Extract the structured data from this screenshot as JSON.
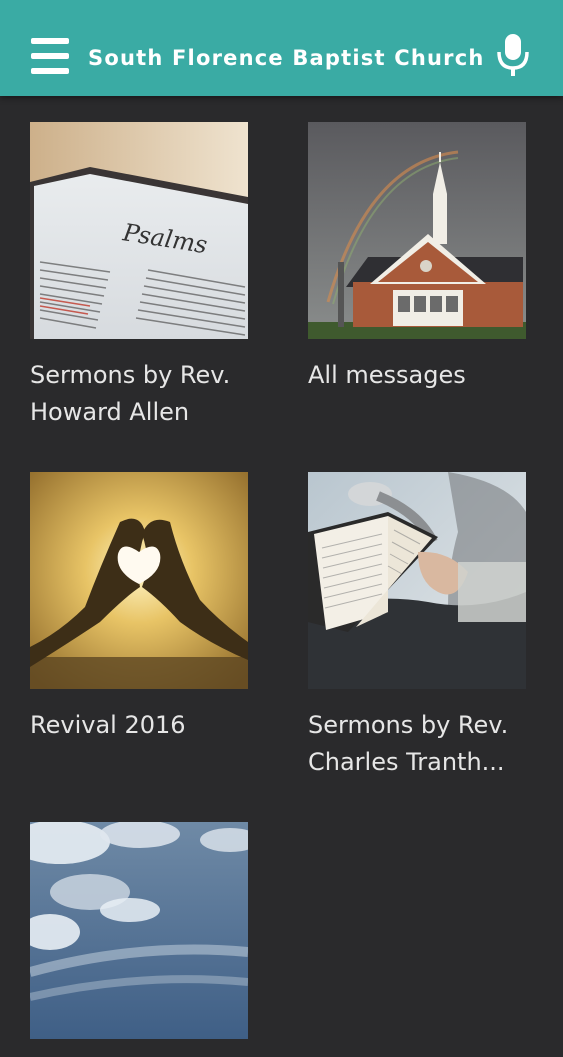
{
  "app": {
    "title": "South Florence Baptist Church",
    "accent_color": "#3aaba4",
    "background_color": "#2a2a2c"
  },
  "toolbar": {
    "menu_icon": "hamburger-menu-icon",
    "mic_icon": "microphone-icon"
  },
  "playlists": [
    {
      "label": "Sermons by Rev. Howard Allen",
      "image": "open-bible-psalms"
    },
    {
      "label": "All messages",
      "image": "church-with-rainbow"
    },
    {
      "label": "Revival 2016",
      "image": "heart-hands-sunset"
    },
    {
      "label": "Sermons by Rev. Charles Tranth...",
      "image": "person-reading-bible"
    },
    {
      "label": "",
      "image": "cloudy-sky"
    }
  ]
}
